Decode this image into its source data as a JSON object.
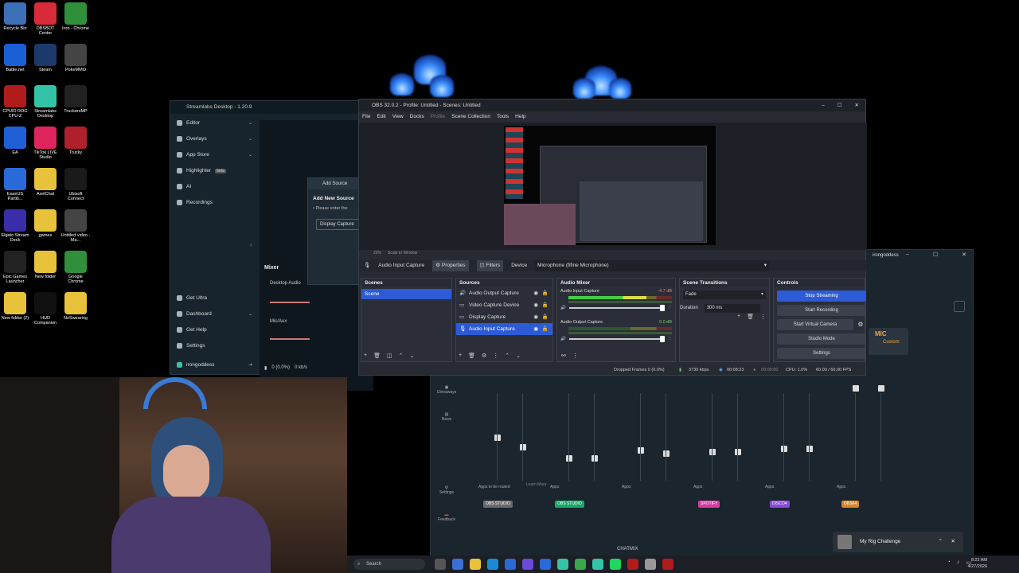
{
  "desktop": {
    "icons": [
      {
        "label": "Recycle Bin",
        "color": "#3d6fb6"
      },
      {
        "label": "OBSBOT Center",
        "color": "#d92b3a"
      },
      {
        "label": "Iron - Chrome",
        "color": "#2f8f3a"
      },
      {
        "label": "Battle.net",
        "color": "#1b5fd6"
      },
      {
        "label": "Steam",
        "color": "#1b3a6b"
      },
      {
        "label": "PokeMMO",
        "color": "#444"
      },
      {
        "label": "CPUID ROG CPU-Z",
        "color": "#b01c1c"
      },
      {
        "label": "Streamlabs Desktop",
        "color": "#34c3a6"
      },
      {
        "label": "TruckersMP",
        "color": "#222"
      },
      {
        "label": "EA",
        "color": "#1f5fd6"
      },
      {
        "label": "TikTok LIVE Studio",
        "color": "#e0245e"
      },
      {
        "label": "Trucky",
        "color": "#b0202a"
      },
      {
        "label": "EaseUS Partiti...",
        "color": "#2a69d8"
      },
      {
        "label": "AxelChat",
        "color": "#e8c23a"
      },
      {
        "label": "Ubisoft Connect",
        "color": "#1a1a1a"
      },
      {
        "label": "Elgato Stream Deck",
        "color": "#3a2ea8"
      },
      {
        "label": "games",
        "color": "#e8c23a"
      },
      {
        "label": "Untitled video - Ma...",
        "color": "#444"
      },
      {
        "label": "Epic Games Launcher",
        "color": "#222"
      },
      {
        "label": "New folder",
        "color": "#e8c23a"
      },
      {
        "label": "Google Chrome",
        "color": "#2f8f3a"
      },
      {
        "label": "New folder (2)",
        "color": "#e8c23a"
      },
      {
        "label": "HUD Companion",
        "color": "#111"
      },
      {
        "label": "NoSwearing",
        "color": "#e8c23a"
      }
    ]
  },
  "streamlabs": {
    "title": "Streamlabs Desktop - 1.20.9",
    "nav": [
      {
        "label": "Editor"
      },
      {
        "label": "Overlays"
      },
      {
        "label": "App Store"
      },
      {
        "label": "Highlighter",
        "badge": "beta"
      },
      {
        "label": "AI"
      },
      {
        "label": "Recordings"
      }
    ],
    "nav_bottom": [
      {
        "label": "Get Ultra"
      },
      {
        "label": "Dashboard"
      },
      {
        "label": "Get Help"
      },
      {
        "label": "Settings"
      },
      {
        "label": "irongoddess"
      }
    ],
    "add_source": {
      "title": "Add Source",
      "heading": "Add New Source",
      "hint": "• Please enter the",
      "button": "Display Capture"
    },
    "mixer": {
      "title": "Mixer",
      "rows": [
        "Desktop Audio",
        "Mic/Aux"
      ]
    },
    "status": "0 (0.0%)",
    "kbps": "0 kb/s",
    "big_window": {
      "user": "irongoddess",
      "mic": "MIC",
      "custom": "Custom",
      "side_nav": [
        "Giveaways",
        "News",
        "Settings",
        "Feedback"
      ],
      "channels": [
        {
          "label": "Apps to be routed",
          "tag": "OBS STUDIO",
          "tag_color": "#6a6a6a"
        },
        {
          "label": "Apps",
          "tag": "OBS STUDIO",
          "tag_color": "#1aa86a"
        },
        {
          "label": "Apps",
          "tag": "",
          "tag_color": ""
        },
        {
          "label": "Apps",
          "tag": "SPOTIFY",
          "tag_color": "#d63ca0"
        },
        {
          "label": "Apps",
          "tag": "DISCO4",
          "tag_color": "#8a4ad6"
        },
        {
          "label": "Apps",
          "tag": "OBS64",
          "tag_color": "#d6862a"
        }
      ],
      "learn_more": "Learn More",
      "chatmix": "CHATMIX"
    }
  },
  "obs": {
    "title": "OBS 32.0.2 - Profile: Untitled - Scenes: Untitled",
    "menu": [
      "File",
      "Edit",
      "View",
      "Docks",
      "Profile",
      "Scene Collection",
      "Tools",
      "Help"
    ],
    "zoom": "20%",
    "scale": "Scale to Window",
    "source_bar": {
      "name": "Audio Input Capture",
      "properties": "Properties",
      "filters": "Filters",
      "device_label": "Device",
      "device": "Microphone (fifine Microphone)"
    },
    "scenes": {
      "title": "Scenes",
      "items": [
        "Scene"
      ]
    },
    "sources": {
      "title": "Sources",
      "items": [
        "Audio Output Capture",
        "Video Capture Device",
        "Display Capture",
        "Audio Input Capture"
      ]
    },
    "audio_mixer": {
      "title": "Audio Mixer",
      "channels": [
        {
          "name": "Audio Input Capture",
          "db": "-4.7 dB",
          "level": 0.75
        },
        {
          "name": "Audio Output Capture",
          "db": "0.0 dB",
          "level": 0.0
        }
      ]
    },
    "transitions": {
      "title": "Scene Transitions",
      "type": "Fade",
      "duration_label": "Duration",
      "duration": "300 ms"
    },
    "controls": {
      "title": "Controls",
      "buttons": [
        "Stop Streaming",
        "Start Recording",
        "Start Virtual Camera",
        "Studio Mode",
        "Settings"
      ]
    },
    "status": {
      "dropped": "Dropped Frames 0 (0.0%)",
      "bitrate": "3739 kbps",
      "time": "00:08:23",
      "rec_time": "00:00:00",
      "cpu": "CPU: 1.0%",
      "fps": "60.00 / 60.00 FPS"
    }
  },
  "notification": {
    "text": "My Rig Challenge"
  },
  "taskbar": {
    "search": "Search",
    "time": "8:22 AM",
    "date": "4/27/2026"
  }
}
